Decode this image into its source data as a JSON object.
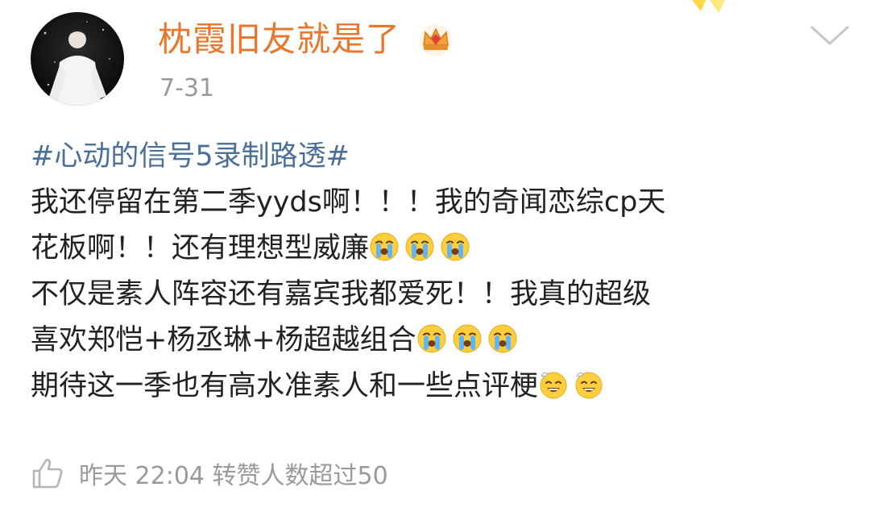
{
  "post": {
    "username": "枕霞旧友就是了",
    "date": "7-31",
    "hashtag": "#心动的信号5录制路透#",
    "lines": [
      "我还停留在第二季yyds啊！！！我的奇闻恋综cp天",
      "花板啊！！还有理想型威廉",
      "不仅是素人阵容还有嘉宾我都爱死！！我真的超级",
      "喜欢郑恺+杨丞琳+杨超越组合",
      "期待这一季也有高水准素人和一些点评梗"
    ],
    "emoji_after_line2": [
      "crying-face-emoji",
      "crying-face-emoji",
      "crying-face-emoji"
    ],
    "emoji_after_line4": [
      "crying-face-emoji",
      "crying-face-emoji",
      "crying-face-emoji"
    ],
    "emoji_after_line5": [
      "grinning-sweat-emoji",
      "grinning-sweat-emoji"
    ]
  },
  "footer": {
    "meta": "昨天 22:04 转赞人数超过50"
  },
  "icons": {
    "badge": "crown-icon",
    "menu": "chevron-down-icon",
    "like": "thumbs-up-icon"
  },
  "colors": {
    "username": "#e8762b",
    "hashtag": "#4a6f99",
    "meta_gray": "#9a9a9a",
    "text": "#222222"
  }
}
